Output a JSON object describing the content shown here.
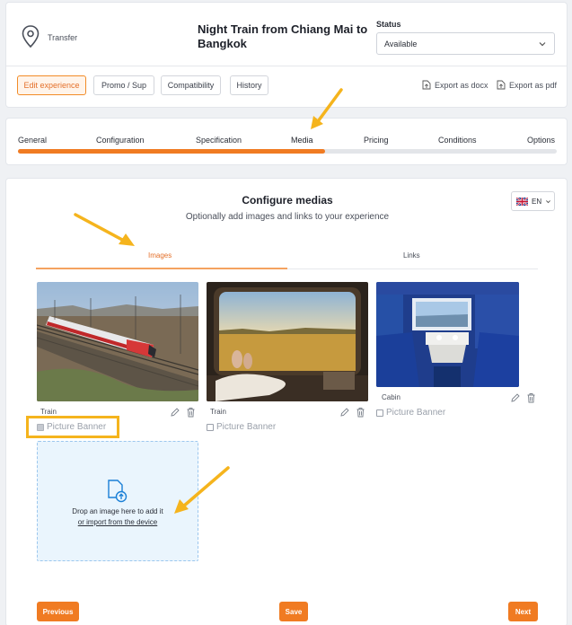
{
  "header": {
    "type_label": "Transfer",
    "title": "Night Train from Chiang Mai to Bangkok",
    "status_label": "Status",
    "status_value": "Available",
    "buttons": [
      "Edit experience",
      "Promo / Sup",
      "Compatibility",
      "History"
    ],
    "export_docx": "Export as docx",
    "export_pdf": "Export as pdf"
  },
  "steps": {
    "items": [
      "General",
      "Configuration",
      "Specification",
      "Media",
      "Pricing",
      "Conditions",
      "Options"
    ],
    "current": "Media",
    "progress_fraction": 0.57
  },
  "main": {
    "title": "Configure medias",
    "subtitle": "Optionally add images and links to your experience",
    "language": "EN",
    "tabs": [
      "Images",
      "Links"
    ],
    "active_tab": "Images",
    "images": [
      {
        "caption": "Train",
        "banner_label": "Picture Banner",
        "banner_checked": true
      },
      {
        "caption": "Train",
        "banner_label": "Picture Banner",
        "banner_checked": false
      },
      {
        "caption": "Cabin",
        "banner_label": "Picture Banner",
        "banner_checked": false
      }
    ],
    "drop": {
      "text": "Drop an image here to add it",
      "link": "or import from the device"
    },
    "buttons": {
      "previous": "Previous",
      "save": "Save",
      "next": "Next"
    }
  },
  "colors": {
    "accent": "#f07b22",
    "highlight": "#f5b41d",
    "drop_bg": "#eaf5fd"
  }
}
